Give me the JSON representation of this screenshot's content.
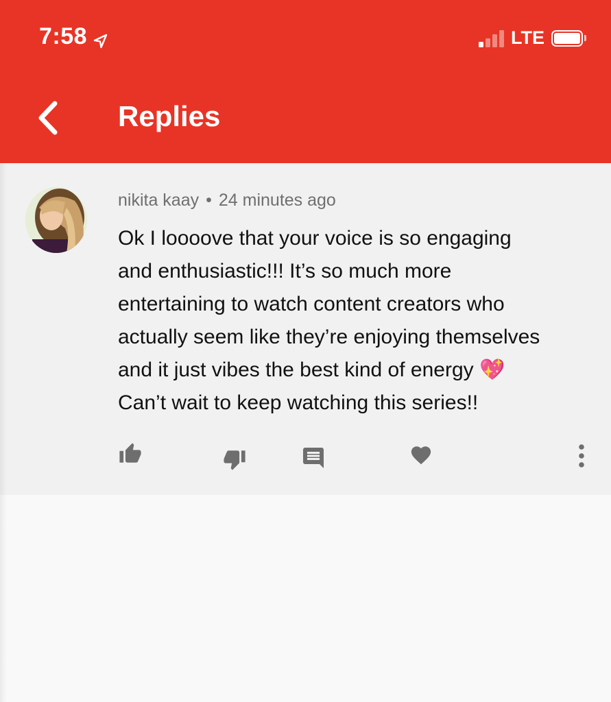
{
  "status_bar": {
    "time": "7:58",
    "location_icon": "location-arrow-icon",
    "network": "LTE",
    "signal_bars_active": 1,
    "signal_bars_total": 4,
    "battery_level": 1.0
  },
  "header": {
    "background_color": "#e83426",
    "back_icon": "chevron-left-icon",
    "title": "Replies"
  },
  "comment": {
    "author": "nikita kaay",
    "separator": "•",
    "timestamp": "24 minutes ago",
    "text": "Ok I loooove that your voice is so engaging\nand enthusiastic!!! It’s so much more\nentertaining to watch content creators who\nactually seem like they’re enjoying themselves\nand it just vibes the best kind of energy 💖\nCan’t wait to keep watching this series!!",
    "actions": [
      {
        "name": "like",
        "icon": "thumbs-up-icon"
      },
      {
        "name": "dislike",
        "icon": "thumbs-down-icon"
      },
      {
        "name": "reply",
        "icon": "comment-icon"
      },
      {
        "name": "heart",
        "icon": "heart-icon"
      },
      {
        "name": "more",
        "icon": "more-vertical-icon"
      }
    ]
  }
}
